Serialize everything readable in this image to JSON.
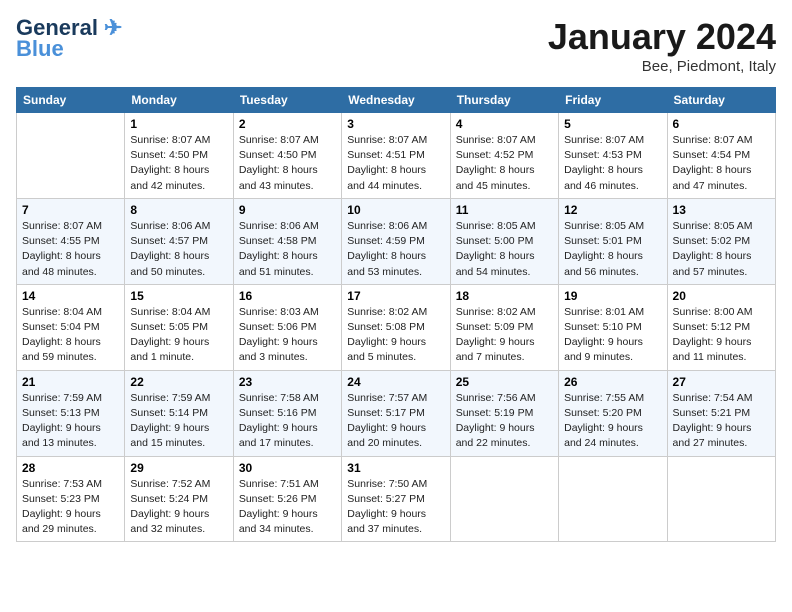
{
  "logo": {
    "line1": "General",
    "line2": "Blue",
    "tagline": ""
  },
  "header": {
    "title": "January 2024",
    "subtitle": "Bee, Piedmont, Italy"
  },
  "columns": [
    "Sunday",
    "Monday",
    "Tuesday",
    "Wednesday",
    "Thursday",
    "Friday",
    "Saturday"
  ],
  "weeks": [
    [
      {
        "day": "",
        "info": ""
      },
      {
        "day": "1",
        "info": "Sunrise: 8:07 AM\nSunset: 4:50 PM\nDaylight: 8 hours\nand 42 minutes."
      },
      {
        "day": "2",
        "info": "Sunrise: 8:07 AM\nSunset: 4:50 PM\nDaylight: 8 hours\nand 43 minutes."
      },
      {
        "day": "3",
        "info": "Sunrise: 8:07 AM\nSunset: 4:51 PM\nDaylight: 8 hours\nand 44 minutes."
      },
      {
        "day": "4",
        "info": "Sunrise: 8:07 AM\nSunset: 4:52 PM\nDaylight: 8 hours\nand 45 minutes."
      },
      {
        "day": "5",
        "info": "Sunrise: 8:07 AM\nSunset: 4:53 PM\nDaylight: 8 hours\nand 46 minutes."
      },
      {
        "day": "6",
        "info": "Sunrise: 8:07 AM\nSunset: 4:54 PM\nDaylight: 8 hours\nand 47 minutes."
      }
    ],
    [
      {
        "day": "7",
        "info": "Sunrise: 8:07 AM\nSunset: 4:55 PM\nDaylight: 8 hours\nand 48 minutes."
      },
      {
        "day": "8",
        "info": "Sunrise: 8:06 AM\nSunset: 4:57 PM\nDaylight: 8 hours\nand 50 minutes."
      },
      {
        "day": "9",
        "info": "Sunrise: 8:06 AM\nSunset: 4:58 PM\nDaylight: 8 hours\nand 51 minutes."
      },
      {
        "day": "10",
        "info": "Sunrise: 8:06 AM\nSunset: 4:59 PM\nDaylight: 8 hours\nand 53 minutes."
      },
      {
        "day": "11",
        "info": "Sunrise: 8:05 AM\nSunset: 5:00 PM\nDaylight: 8 hours\nand 54 minutes."
      },
      {
        "day": "12",
        "info": "Sunrise: 8:05 AM\nSunset: 5:01 PM\nDaylight: 8 hours\nand 56 minutes."
      },
      {
        "day": "13",
        "info": "Sunrise: 8:05 AM\nSunset: 5:02 PM\nDaylight: 8 hours\nand 57 minutes."
      }
    ],
    [
      {
        "day": "14",
        "info": "Sunrise: 8:04 AM\nSunset: 5:04 PM\nDaylight: 8 hours\nand 59 minutes."
      },
      {
        "day": "15",
        "info": "Sunrise: 8:04 AM\nSunset: 5:05 PM\nDaylight: 9 hours\nand 1 minute."
      },
      {
        "day": "16",
        "info": "Sunrise: 8:03 AM\nSunset: 5:06 PM\nDaylight: 9 hours\nand 3 minutes."
      },
      {
        "day": "17",
        "info": "Sunrise: 8:02 AM\nSunset: 5:08 PM\nDaylight: 9 hours\nand 5 minutes."
      },
      {
        "day": "18",
        "info": "Sunrise: 8:02 AM\nSunset: 5:09 PM\nDaylight: 9 hours\nand 7 minutes."
      },
      {
        "day": "19",
        "info": "Sunrise: 8:01 AM\nSunset: 5:10 PM\nDaylight: 9 hours\nand 9 minutes."
      },
      {
        "day": "20",
        "info": "Sunrise: 8:00 AM\nSunset: 5:12 PM\nDaylight: 9 hours\nand 11 minutes."
      }
    ],
    [
      {
        "day": "21",
        "info": "Sunrise: 7:59 AM\nSunset: 5:13 PM\nDaylight: 9 hours\nand 13 minutes."
      },
      {
        "day": "22",
        "info": "Sunrise: 7:59 AM\nSunset: 5:14 PM\nDaylight: 9 hours\nand 15 minutes."
      },
      {
        "day": "23",
        "info": "Sunrise: 7:58 AM\nSunset: 5:16 PM\nDaylight: 9 hours\nand 17 minutes."
      },
      {
        "day": "24",
        "info": "Sunrise: 7:57 AM\nSunset: 5:17 PM\nDaylight: 9 hours\nand 20 minutes."
      },
      {
        "day": "25",
        "info": "Sunrise: 7:56 AM\nSunset: 5:19 PM\nDaylight: 9 hours\nand 22 minutes."
      },
      {
        "day": "26",
        "info": "Sunrise: 7:55 AM\nSunset: 5:20 PM\nDaylight: 9 hours\nand 24 minutes."
      },
      {
        "day": "27",
        "info": "Sunrise: 7:54 AM\nSunset: 5:21 PM\nDaylight: 9 hours\nand 27 minutes."
      }
    ],
    [
      {
        "day": "28",
        "info": "Sunrise: 7:53 AM\nSunset: 5:23 PM\nDaylight: 9 hours\nand 29 minutes."
      },
      {
        "day": "29",
        "info": "Sunrise: 7:52 AM\nSunset: 5:24 PM\nDaylight: 9 hours\nand 32 minutes."
      },
      {
        "day": "30",
        "info": "Sunrise: 7:51 AM\nSunset: 5:26 PM\nDaylight: 9 hours\nand 34 minutes."
      },
      {
        "day": "31",
        "info": "Sunrise: 7:50 AM\nSunset: 5:27 PM\nDaylight: 9 hours\nand 37 minutes."
      },
      {
        "day": "",
        "info": ""
      },
      {
        "day": "",
        "info": ""
      },
      {
        "day": "",
        "info": ""
      }
    ]
  ]
}
